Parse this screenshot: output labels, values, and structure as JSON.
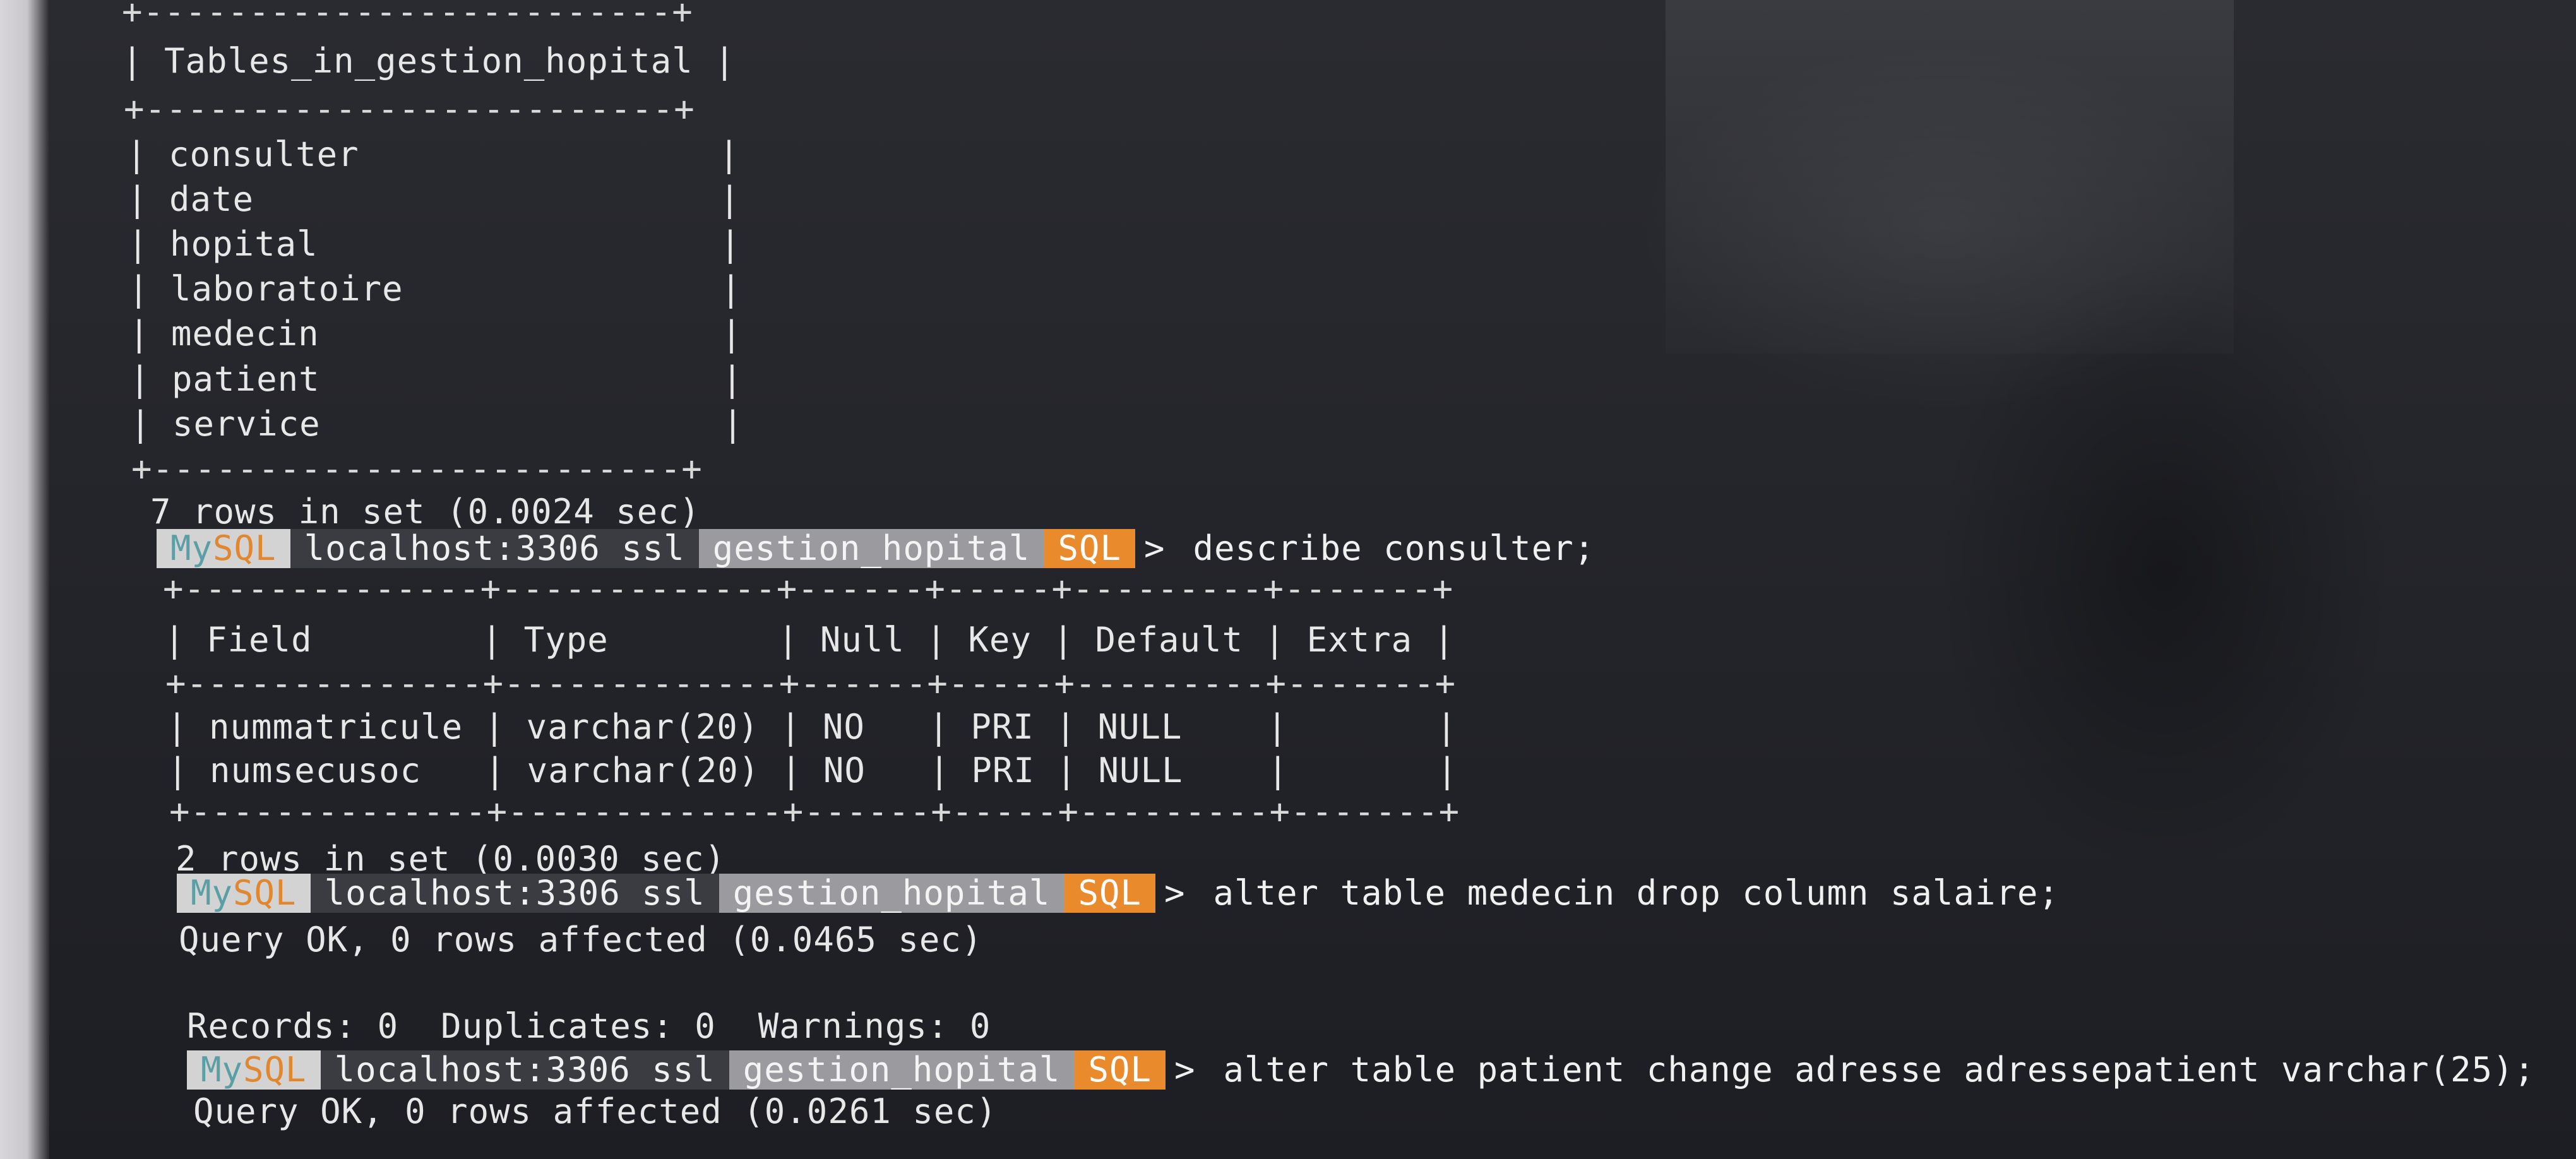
{
  "prompt": {
    "mysql_my": "My",
    "mysql_sql": "SQL",
    "host": "localhost:3306 ssl",
    "database": "gestion_hopital",
    "mode": "SQL",
    "arrow": ">"
  },
  "tables_result": {
    "border_top": "+-------------------------+",
    "header": "| Tables_in_gestion_hopital |",
    "border_mid": "+-------------------------+",
    "rows": [
      "| consulter                 |",
      "| date                      |",
      "| hopital                   |",
      "| laboratoire               |",
      "| medecin                   |",
      "| patient                   |",
      "| service                   |"
    ],
    "border_bottom": "+-------------------------+",
    "summary": "7 rows in set (0.0024 sec)"
  },
  "command_1": "describe consulter;",
  "describe_result": {
    "border_top": "+--------------+-------------+------+-----+---------+-------+",
    "header": "| Field        | Type        | Null | Key | Default | Extra |",
    "border_mid": "+--------------+-------------+------+-----+---------+-------+",
    "rows": [
      "| nummatricule | varchar(20) | NO   | PRI | NULL    |       |",
      "| numsecusoc   | varchar(20) | NO   | PRI | NULL    |       |"
    ],
    "border_bottom": "+--------------+-------------+------+-----+---------+-------+",
    "summary": "2 rows in set (0.0030 sec)"
  },
  "command_2": "alter table medecin drop column salaire;",
  "result_2": {
    "line1": "Query OK, 0 rows affected (0.0465 sec)",
    "line2": "Records: 0  Duplicates: 0  Warnings: 0"
  },
  "command_3": "alter table patient change adresse adressepatient varchar(25);",
  "result_3": {
    "line1": "Query OK, 0 rows affected (0.0261 sec)"
  }
}
